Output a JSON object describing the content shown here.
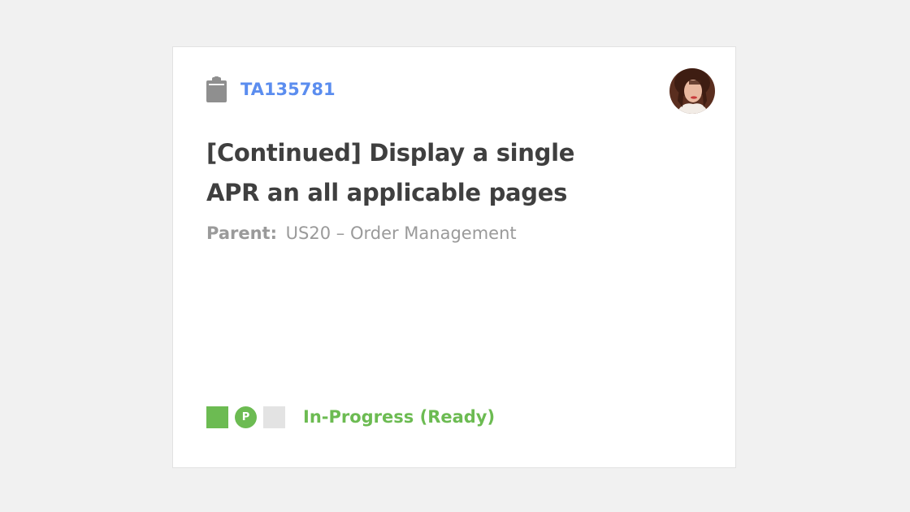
{
  "card": {
    "icon": "clipboard-icon",
    "task_id": "TA135781",
    "title": "[Continued] Display a single APR an all applicable pages",
    "parent_label": "Parent:",
    "parent_value": "US20 – Order Management",
    "avatar": "user-avatar",
    "schedule_state": {
      "defined_color": "#6cbb52",
      "in_progress_letter": "P",
      "in_progress_color": "#6cbb52",
      "completed_color": "#e3e3e3",
      "status_text": "In-Progress (Ready)",
      "status_color": "#6cbb52"
    },
    "accent_color": "#5b8def"
  }
}
